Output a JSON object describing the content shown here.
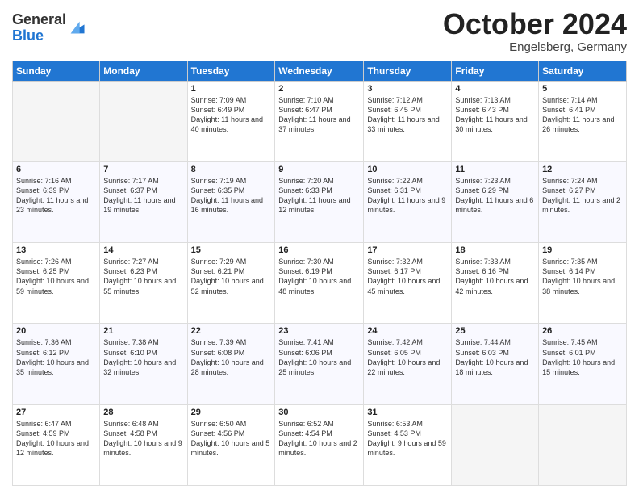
{
  "header": {
    "logo_general": "General",
    "logo_blue": "Blue",
    "month": "October 2024",
    "location": "Engelsberg, Germany"
  },
  "days_of_week": [
    "Sunday",
    "Monday",
    "Tuesday",
    "Wednesday",
    "Thursday",
    "Friday",
    "Saturday"
  ],
  "weeks": [
    [
      {
        "day": "",
        "content": ""
      },
      {
        "day": "",
        "content": ""
      },
      {
        "day": "1",
        "content": "Sunrise: 7:09 AM\nSunset: 6:49 PM\nDaylight: 11 hours and 40 minutes."
      },
      {
        "day": "2",
        "content": "Sunrise: 7:10 AM\nSunset: 6:47 PM\nDaylight: 11 hours and 37 minutes."
      },
      {
        "day": "3",
        "content": "Sunrise: 7:12 AM\nSunset: 6:45 PM\nDaylight: 11 hours and 33 minutes."
      },
      {
        "day": "4",
        "content": "Sunrise: 7:13 AM\nSunset: 6:43 PM\nDaylight: 11 hours and 30 minutes."
      },
      {
        "day": "5",
        "content": "Sunrise: 7:14 AM\nSunset: 6:41 PM\nDaylight: 11 hours and 26 minutes."
      }
    ],
    [
      {
        "day": "6",
        "content": "Sunrise: 7:16 AM\nSunset: 6:39 PM\nDaylight: 11 hours and 23 minutes."
      },
      {
        "day": "7",
        "content": "Sunrise: 7:17 AM\nSunset: 6:37 PM\nDaylight: 11 hours and 19 minutes."
      },
      {
        "day": "8",
        "content": "Sunrise: 7:19 AM\nSunset: 6:35 PM\nDaylight: 11 hours and 16 minutes."
      },
      {
        "day": "9",
        "content": "Sunrise: 7:20 AM\nSunset: 6:33 PM\nDaylight: 11 hours and 12 minutes."
      },
      {
        "day": "10",
        "content": "Sunrise: 7:22 AM\nSunset: 6:31 PM\nDaylight: 11 hours and 9 minutes."
      },
      {
        "day": "11",
        "content": "Sunrise: 7:23 AM\nSunset: 6:29 PM\nDaylight: 11 hours and 6 minutes."
      },
      {
        "day": "12",
        "content": "Sunrise: 7:24 AM\nSunset: 6:27 PM\nDaylight: 11 hours and 2 minutes."
      }
    ],
    [
      {
        "day": "13",
        "content": "Sunrise: 7:26 AM\nSunset: 6:25 PM\nDaylight: 10 hours and 59 minutes."
      },
      {
        "day": "14",
        "content": "Sunrise: 7:27 AM\nSunset: 6:23 PM\nDaylight: 10 hours and 55 minutes."
      },
      {
        "day": "15",
        "content": "Sunrise: 7:29 AM\nSunset: 6:21 PM\nDaylight: 10 hours and 52 minutes."
      },
      {
        "day": "16",
        "content": "Sunrise: 7:30 AM\nSunset: 6:19 PM\nDaylight: 10 hours and 48 minutes."
      },
      {
        "day": "17",
        "content": "Sunrise: 7:32 AM\nSunset: 6:17 PM\nDaylight: 10 hours and 45 minutes."
      },
      {
        "day": "18",
        "content": "Sunrise: 7:33 AM\nSunset: 6:16 PM\nDaylight: 10 hours and 42 minutes."
      },
      {
        "day": "19",
        "content": "Sunrise: 7:35 AM\nSunset: 6:14 PM\nDaylight: 10 hours and 38 minutes."
      }
    ],
    [
      {
        "day": "20",
        "content": "Sunrise: 7:36 AM\nSunset: 6:12 PM\nDaylight: 10 hours and 35 minutes."
      },
      {
        "day": "21",
        "content": "Sunrise: 7:38 AM\nSunset: 6:10 PM\nDaylight: 10 hours and 32 minutes."
      },
      {
        "day": "22",
        "content": "Sunrise: 7:39 AM\nSunset: 6:08 PM\nDaylight: 10 hours and 28 minutes."
      },
      {
        "day": "23",
        "content": "Sunrise: 7:41 AM\nSunset: 6:06 PM\nDaylight: 10 hours and 25 minutes."
      },
      {
        "day": "24",
        "content": "Sunrise: 7:42 AM\nSunset: 6:05 PM\nDaylight: 10 hours and 22 minutes."
      },
      {
        "day": "25",
        "content": "Sunrise: 7:44 AM\nSunset: 6:03 PM\nDaylight: 10 hours and 18 minutes."
      },
      {
        "day": "26",
        "content": "Sunrise: 7:45 AM\nSunset: 6:01 PM\nDaylight: 10 hours and 15 minutes."
      }
    ],
    [
      {
        "day": "27",
        "content": "Sunrise: 6:47 AM\nSunset: 4:59 PM\nDaylight: 10 hours and 12 minutes."
      },
      {
        "day": "28",
        "content": "Sunrise: 6:48 AM\nSunset: 4:58 PM\nDaylight: 10 hours and 9 minutes."
      },
      {
        "day": "29",
        "content": "Sunrise: 6:50 AM\nSunset: 4:56 PM\nDaylight: 10 hours and 5 minutes."
      },
      {
        "day": "30",
        "content": "Sunrise: 6:52 AM\nSunset: 4:54 PM\nDaylight: 10 hours and 2 minutes."
      },
      {
        "day": "31",
        "content": "Sunrise: 6:53 AM\nSunset: 4:53 PM\nDaylight: 9 hours and 59 minutes."
      },
      {
        "day": "",
        "content": ""
      },
      {
        "day": "",
        "content": ""
      }
    ]
  ]
}
